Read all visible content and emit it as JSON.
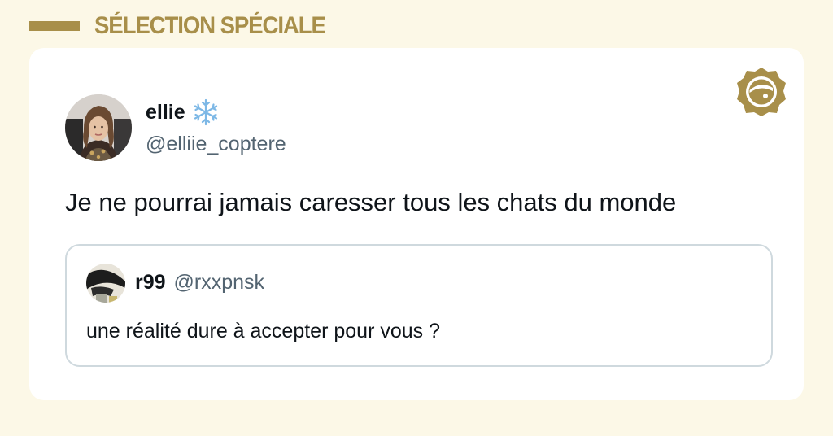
{
  "header": {
    "title": "SÉLECTION SPÉCIALE"
  },
  "tweet": {
    "author_name": "ellie",
    "author_handle": "@elliie_coptere",
    "name_emoji": "snowflake-icon",
    "text": "Je ne pourrai jamais caresser tous les chats du monde",
    "quote": {
      "author_name": "r99",
      "author_handle": "@rxxpnsk",
      "text": "une réalité dure à accepter pour vous ?"
    }
  },
  "colors": {
    "page_background": "#fcf8e7",
    "accent_gold": "#a88f4a",
    "card_background": "#ffffff",
    "text_primary": "#0f1419",
    "text_secondary": "#536471",
    "quote_border": "#cfd9de",
    "snowflake_blue": "#7db8e6"
  }
}
